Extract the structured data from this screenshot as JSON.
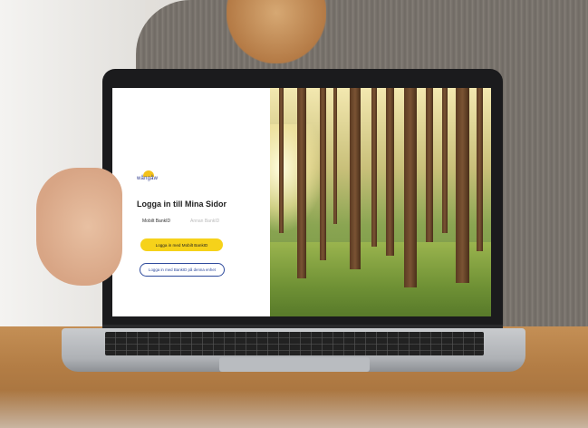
{
  "login": {
    "logo_text": "wångåw",
    "title": "Logga in till Mina Sidor",
    "tabs": [
      {
        "label": "Mobilt BankID",
        "active": true
      },
      {
        "label": "Annan BankID",
        "active": false
      }
    ],
    "primary_button": "Logga in med Mobilt BankID",
    "secondary_button": "Logga in med BankID på denna enhet"
  },
  "colors": {
    "primary_button": "#f6d21a",
    "secondary_border": "#2e4a9c",
    "logo_sun": "#f4c21a"
  },
  "icons": [
    "sun-logo-icon"
  ]
}
